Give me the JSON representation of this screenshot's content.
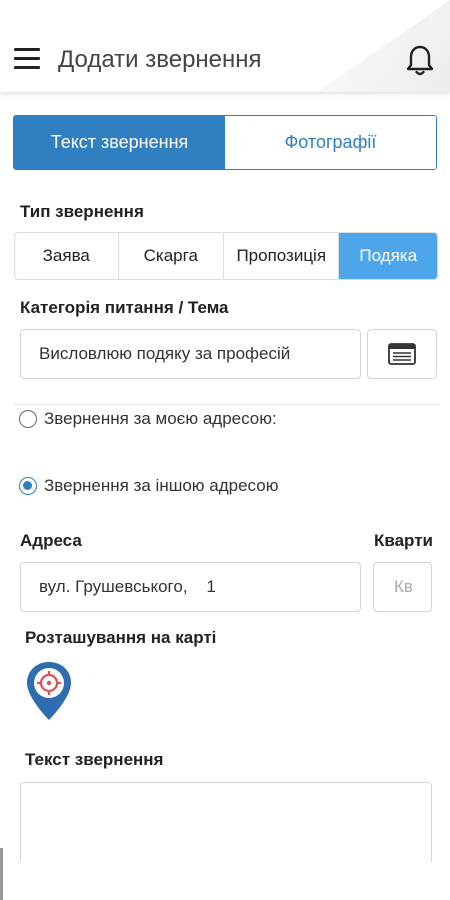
{
  "header": {
    "title": "Додати звернення",
    "menu_icon": "hamburger-menu-icon",
    "bell_icon": "bell-icon"
  },
  "tabs": [
    {
      "label": "Текст звернення",
      "active": true
    },
    {
      "label": "Фотографії",
      "active": false
    }
  ],
  "type_section": {
    "label": "Тип звернення",
    "options": [
      "Заява",
      "Скарга",
      "Пропозиція",
      "Подяка"
    ],
    "selected": "Подяка"
  },
  "category": {
    "label": "Категорія питання / Тема",
    "value": "Висловлюю подяку за професій",
    "button_icon": "list-icon"
  },
  "address_choice": {
    "my_address": {
      "label": "Звернення за моєю адресою:",
      "checked": false
    },
    "other_address": {
      "label": "Звернення за іншою адресою",
      "checked": true
    }
  },
  "address": {
    "label": "Адреса",
    "value": "вул. Грушевського,    1",
    "apartment_label": "Кварти",
    "apartment_placeholder": "Кв"
  },
  "map": {
    "label": "Розташування на карті",
    "icon": "map-pin-target-icon"
  },
  "text_section": {
    "label": "Текст звернення",
    "value": ""
  },
  "colors": {
    "accent": "#2f7fc1",
    "selected_type": "#4ea6ea",
    "pin": "#2f6cb0",
    "pin_target": "#e05050"
  }
}
